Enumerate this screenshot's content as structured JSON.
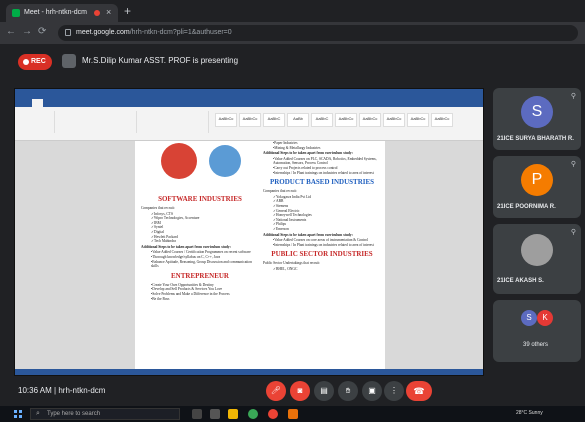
{
  "browser": {
    "tab_title": "Meet - hrh-ntkn-dcm",
    "url_host": "meet.google.com",
    "url_path": "/hrh-ntkn-dcm?pli=1&authuser=0"
  },
  "presenting": {
    "rec_label": "REC",
    "presenter_text": "Mr.S.Dilip Kumar ASST. PROF is presenting"
  },
  "document": {
    "left": {
      "heading1": "SOFTWARE INDUSTRIES",
      "companies_intro": "Companies that recruit:",
      "companies": [
        "Infosys, CTS",
        "Wipro Technologies, Accenture",
        "IBM",
        "Syntel",
        "Digital",
        "Hewlett Packard",
        "Tech Mahindra"
      ],
      "steps_title": "Additional Steps to be taken apart from curriculum study:",
      "steps": [
        "Value Added Courses / Certification Programmes on recent software",
        "Thorough knowledge/syllabus on C, C++, Java",
        "Enhance Aptitude, Reasoning, Group Discussion and communication skills"
      ],
      "heading2": "ENTREPRENEUR",
      "entre": [
        "Create Your Own Opportunities & Destiny",
        "Develop and Sell Products & Services You Love",
        "Solve Problems and Make a Difference in the Process",
        "Be the Boss"
      ]
    },
    "right": {
      "top_items": [
        "Paper Industries",
        "Mining & Metallurgy Industries"
      ],
      "steps_title": "Additional Steps to be taken apart from curriculum study:",
      "steps": [
        "Value Added Courses on PLC, SCADA, Robotics, Embedded Systems, Automation, Sensors, Process Control",
        "Carry out Projects related to process control",
        "Internships / In Plant trainings on industries related to area of interest"
      ],
      "heading1": "PRODUCT BASED INDUSTRIES",
      "companies_intro": "Companies that recruit:",
      "companies": [
        "Yokogawa India Pvt Ltd",
        "ABB",
        "Siemens",
        "General Electric",
        "Honeywell Technologies",
        "National Instruments",
        "Philips",
        "Emerson"
      ],
      "steps2_title": "Additional Steps to be taken apart from curriculum study:",
      "steps2": [
        "Value Added Courses on core areas of instrumentation & Control",
        "Internships / In Plant trainings on industries related to area of interest"
      ],
      "heading2": "PUBLIC SECTOR INDUSTRIES",
      "psu_intro": "Public Sector Undertakings that recruit:",
      "psu": [
        "BHEL, ONGC"
      ]
    }
  },
  "participants": [
    {
      "initial": "S",
      "name": "21ICE SURYA BHARATH R.",
      "color": "#5c6bc0"
    },
    {
      "initial": "P",
      "name": "21ICE POORNIMA R.",
      "color": "#f57c00"
    },
    {
      "initial": "",
      "name": "21ICE AKASH S.",
      "color": "#9e9e9e"
    }
  ],
  "others": {
    "label": "39 others",
    "initials": [
      "S",
      "K"
    ],
    "colors": [
      "#5c6bc0",
      "#e53935"
    ]
  },
  "meeting": {
    "time_code": "10:36 AM  |  hrh-ntkn-dcm"
  },
  "taskbar": {
    "search_placeholder": "Type here to search",
    "weather": "28°C Sunny"
  }
}
